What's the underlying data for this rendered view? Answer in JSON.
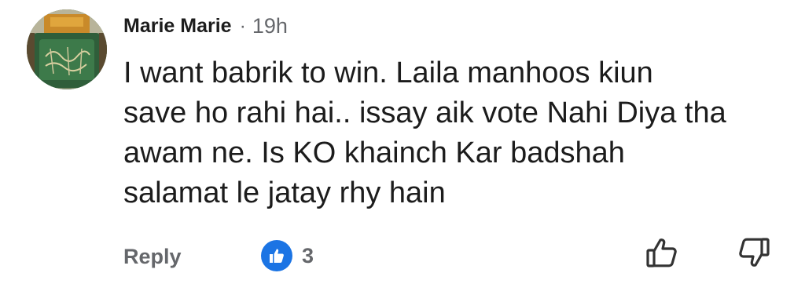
{
  "comment": {
    "author": "Marie Marie",
    "separator": "·",
    "time": "19h",
    "text_lines": [
      "I want babrik to win. Laila manhoos kiun",
      "save ho rahi hai.. issay aik vote Nahi Diya tha",
      "awam ne. Is KO khainch Kar badshah",
      "salamat le jatay rhy hain"
    ],
    "reply_label": "Reply",
    "like_count": "3"
  },
  "icons": {
    "reaction": "like-icon",
    "upvote": "thumbs-up-icon",
    "downvote": "thumbs-down-icon"
  },
  "colors": {
    "text": "#1c1c1c",
    "muted": "#65676b",
    "like_blue": "#1b74e4"
  }
}
